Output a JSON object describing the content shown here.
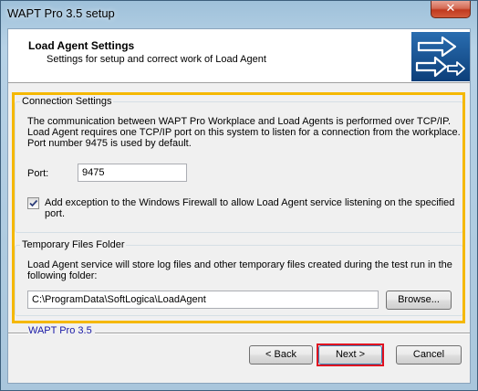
{
  "window": {
    "title": "WAPT Pro 3.5 setup",
    "close_glyph": "✕"
  },
  "header": {
    "title": "Load Agent Settings",
    "subtitle": "Settings for setup and correct work of Load Agent",
    "logo_icon": "arrows-logo-icon"
  },
  "connection": {
    "group_title": "Connection Settings",
    "description": [
      "The communication between WAPT Pro Workplace and Load Agents is performed over TCP/IP.",
      "Load Agent requires one TCP/IP port on this system to listen for a connection from the workplace.",
      "Port number 9475 is used by default."
    ],
    "port_label": "Port:",
    "port_value": "9475",
    "firewall_checked": true,
    "firewall_label_lines": [
      "Add exception to the Windows Firewall to allow Load Agent service listening on the specified",
      "port."
    ]
  },
  "temp": {
    "group_title": "Temporary Files Folder",
    "description": [
      "Load Agent service will store log files and other temporary files created during the test run in the",
      "following folder:"
    ],
    "folder_path": "C:\\ProgramData\\SoftLogica\\LoadAgent",
    "browse_label": "Browse..."
  },
  "footer": {
    "brand": "WAPT Pro 3.5",
    "back_label": "< Back",
    "next_label": "Next >",
    "cancel_label": "Cancel"
  },
  "colors": {
    "highlight_box": "#f5b800",
    "next_outline": "#e01020",
    "brand_text": "#1a1aa6"
  }
}
